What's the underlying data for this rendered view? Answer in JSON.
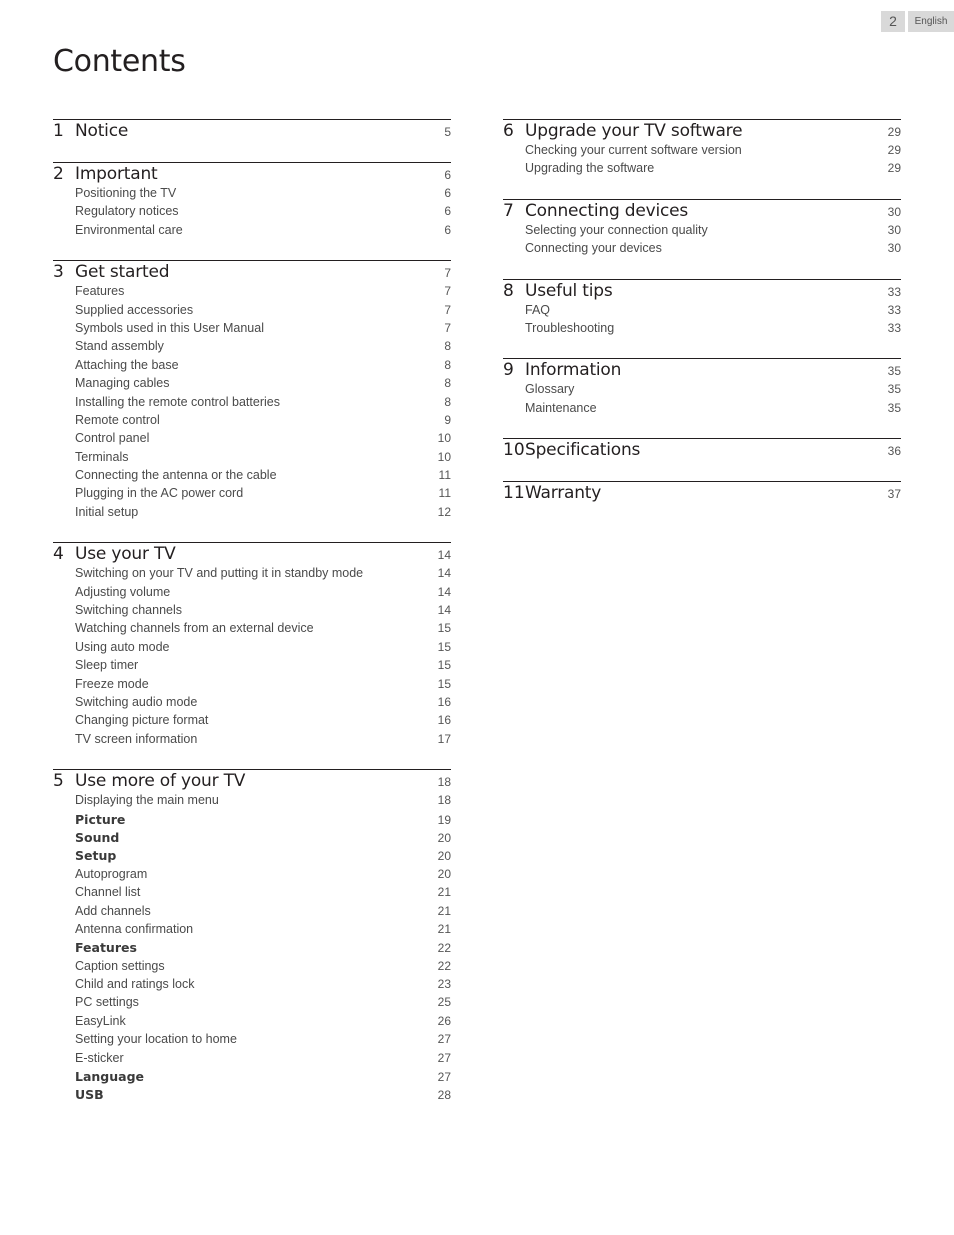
{
  "header": {
    "page_number": "2",
    "language": "English"
  },
  "title": "Contents",
  "columns": [
    {
      "sections": [
        {
          "num": "1",
          "title": "Notice",
          "page": "5",
          "items": []
        },
        {
          "num": "2",
          "title": "Important",
          "page": "6",
          "items": [
            {
              "title": "Positioning the TV",
              "page": "6",
              "bold": false
            },
            {
              "title": "Regulatory notices",
              "page": "6",
              "bold": false
            },
            {
              "title": "Environmental care",
              "page": "6",
              "bold": false
            }
          ]
        },
        {
          "num": "3",
          "title": "Get started",
          "page": "7",
          "items": [
            {
              "title": "Features",
              "page": "7",
              "bold": false
            },
            {
              "title": "Supplied accessories",
              "page": "7",
              "bold": false
            },
            {
              "title": "Symbols used in this User Manual",
              "page": "7",
              "bold": false
            },
            {
              "title": "Stand assembly",
              "page": "8",
              "bold": false
            },
            {
              "title": "Attaching the base",
              "page": "8",
              "bold": false
            },
            {
              "title": "Managing cables",
              "page": "8",
              "bold": false
            },
            {
              "title": "Installing the remote control batteries",
              "page": "8",
              "bold": false
            },
            {
              "title": "Remote control",
              "page": "9",
              "bold": false
            },
            {
              "title": "Control panel",
              "page": "10",
              "bold": false
            },
            {
              "title": "Terminals",
              "page": "10",
              "bold": false
            },
            {
              "title": "Connecting the antenna or the cable",
              "page": "11",
              "bold": false
            },
            {
              "title": "Plugging in the AC power cord",
              "page": "11",
              "bold": false
            },
            {
              "title": "Initial setup",
              "page": "12",
              "bold": false
            }
          ]
        },
        {
          "num": "4",
          "title": "Use your TV",
          "page": "14",
          "items": [
            {
              "title": "Switching on your TV and putting it in standby mode",
              "page": "14",
              "bold": false
            },
            {
              "title": "Adjusting volume",
              "page": "14",
              "bold": false
            },
            {
              "title": "Switching channels",
              "page": "14",
              "bold": false
            },
            {
              "title": "Watching channels from an external device",
              "page": "15",
              "bold": false
            },
            {
              "title": "Using auto mode",
              "page": "15",
              "bold": false
            },
            {
              "title": "Sleep timer",
              "page": "15",
              "bold": false
            },
            {
              "title": "Freeze mode",
              "page": "15",
              "bold": false
            },
            {
              "title": "Switching audio mode",
              "page": "16",
              "bold": false
            },
            {
              "title": "Changing picture format",
              "page": "16",
              "bold": false
            },
            {
              "title": "TV screen information",
              "page": "17",
              "bold": false
            }
          ]
        },
        {
          "num": "5",
          "title": "Use more of your TV",
          "page": "18",
          "items": [
            {
              "title": "Displaying the main menu",
              "page": "18",
              "bold": false
            },
            {
              "title": "Picture",
              "page": "19",
              "bold": true
            },
            {
              "title": "Sound",
              "page": "20",
              "bold": true
            },
            {
              "title": "Setup",
              "page": "20",
              "bold": true
            },
            {
              "title": "Autoprogram",
              "page": "20",
              "bold": false
            },
            {
              "title": "Channel list",
              "page": "21",
              "bold": false
            },
            {
              "title": "Add channels",
              "page": "21",
              "bold": false
            },
            {
              "title": "Antenna confirmation",
              "page": "21",
              "bold": false
            },
            {
              "title": "Features",
              "page": "22",
              "bold": true
            },
            {
              "title": "Caption settings",
              "page": "22",
              "bold": false
            },
            {
              "title": "Child and ratings lock",
              "page": "23",
              "bold": false
            },
            {
              "title": "PC settings",
              "page": "25",
              "bold": false
            },
            {
              "title": "EasyLink",
              "page": "26",
              "bold": false
            },
            {
              "title": "Setting your location to home",
              "page": "27",
              "bold": false
            },
            {
              "title": "E-sticker",
              "page": "27",
              "bold": false
            },
            {
              "title": "Language",
              "page": "27",
              "bold": true
            },
            {
              "title": "USB",
              "page": "28",
              "bold": true
            }
          ]
        }
      ]
    },
    {
      "sections": [
        {
          "num": "6",
          "title": "Upgrade your TV software",
          "page": "29",
          "items": [
            {
              "title": "Checking your current software version",
              "page": "29",
              "bold": false
            },
            {
              "title": "Upgrading the software",
              "page": "29",
              "bold": false
            }
          ]
        },
        {
          "num": "7",
          "title": "Connecting devices",
          "page": "30",
          "items": [
            {
              "title": "Selecting your connection quality",
              "page": "30",
              "bold": false
            },
            {
              "title": "Connecting your devices",
              "page": "30",
              "bold": false
            }
          ]
        },
        {
          "num": "8",
          "title": "Useful tips",
          "page": "33",
          "items": [
            {
              "title": "FAQ",
              "page": "33",
              "bold": false
            },
            {
              "title": "Troubleshooting",
              "page": "33",
              "bold": false
            }
          ]
        },
        {
          "num": "9",
          "title": "Information",
          "page": "35",
          "items": [
            {
              "title": "Glossary",
              "page": "35",
              "bold": false
            },
            {
              "title": "Maintenance",
              "page": "35",
              "bold": false
            }
          ]
        },
        {
          "num": "10",
          "title": "Specifications",
          "page": "36",
          "items": []
        },
        {
          "num": "11",
          "title": "Warranty",
          "page": "37",
          "items": []
        }
      ]
    }
  ]
}
